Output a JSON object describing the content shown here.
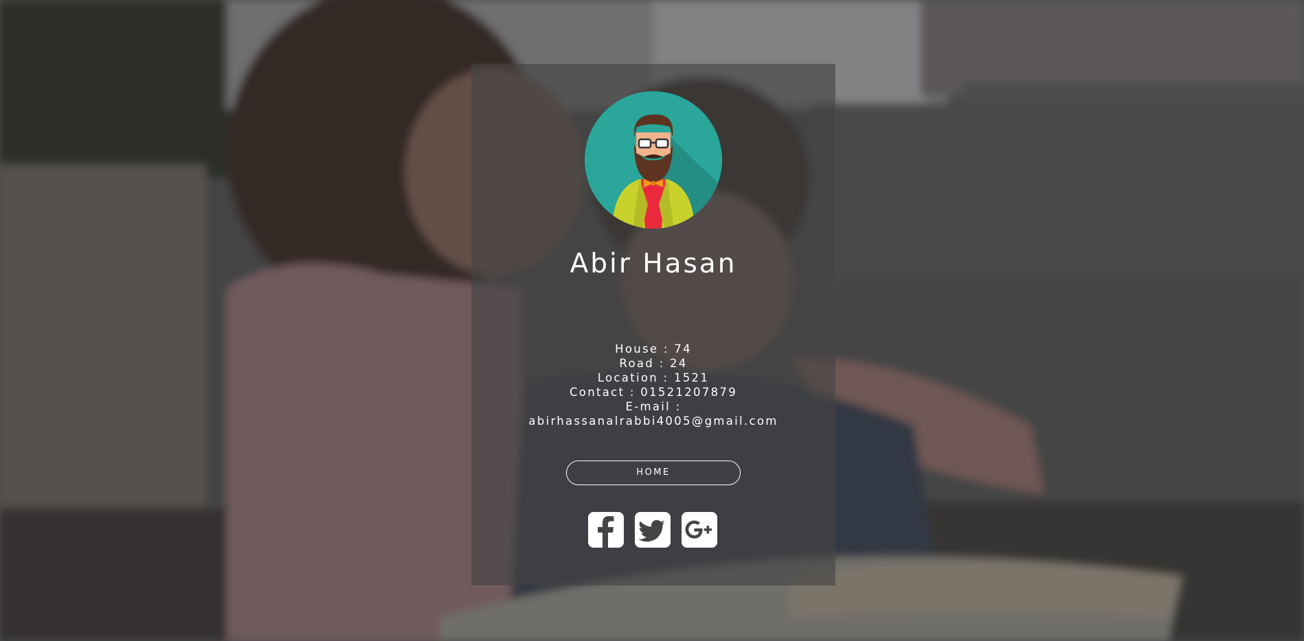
{
  "profile": {
    "name": "Abir Hasan",
    "avatar_icon": "bearded-man-avatar-icon"
  },
  "info": {
    "house": "House : 74",
    "road": "Road : 24",
    "location": "Location : 1521",
    "contact": "Contact : 01521207879",
    "email_label": "E-mail :",
    "email_value": "abirhassanalrabbi4005@gmail.com"
  },
  "nav": {
    "home_label": "HOME"
  },
  "social": [
    {
      "icon": "facebook-icon"
    },
    {
      "icon": "twitter-icon"
    },
    {
      "icon": "google-plus-icon"
    }
  ],
  "colors": {
    "avatar_bg": "#2aa69a",
    "card_overlay": "rgba(68,68,68,0.62)",
    "text": "#ffffff"
  }
}
